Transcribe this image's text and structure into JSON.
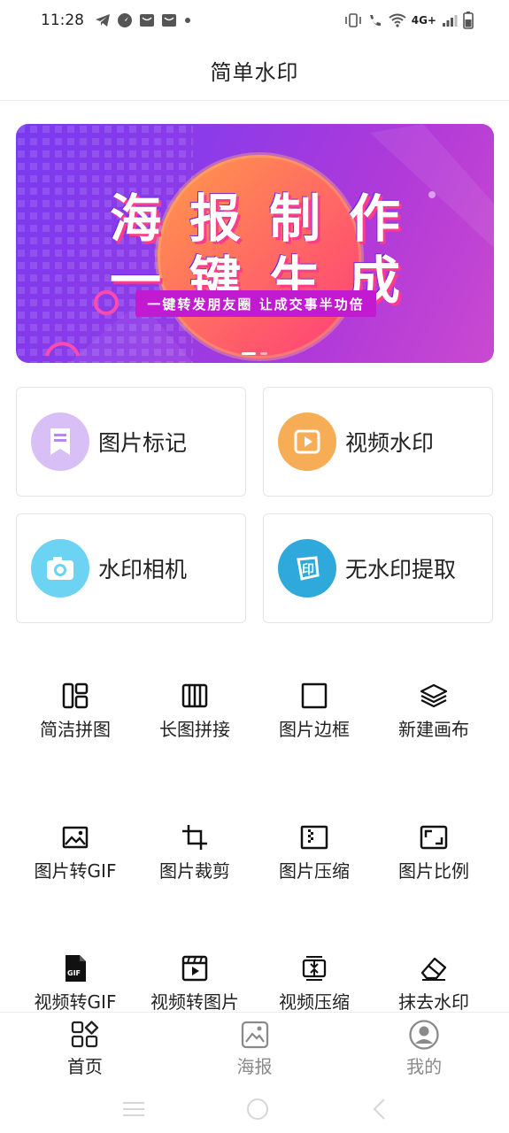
{
  "status_bar": {
    "time": "11:28",
    "network": "4G+"
  },
  "header": {
    "title": "简单水印"
  },
  "banner": {
    "line1": "海报制作",
    "line2": "一键生成",
    "subtitle": "一键转发朋友圈 让成交事半功倍",
    "slide_count": 2,
    "active_slide": 1
  },
  "feature_cards": [
    {
      "label": "图片标记",
      "icon": "bookmark-icon",
      "color": "#c9a6f0"
    },
    {
      "label": "视频水印",
      "icon": "play-icon",
      "color": "#f5a84b"
    },
    {
      "label": "水印相机",
      "icon": "camera-icon",
      "color": "#5bcff0"
    },
    {
      "label": "无水印提取",
      "icon": "print-seal-icon",
      "color": "#2fa8dc"
    }
  ],
  "tools": [
    {
      "label": "简洁拼图",
      "icon": "layout-grid-icon"
    },
    {
      "label": "长图拼接",
      "icon": "columns-icon"
    },
    {
      "label": "图片边框",
      "icon": "square-frame-icon"
    },
    {
      "label": "新建画布",
      "icon": "layers-icon"
    },
    {
      "label": "图片转GIF",
      "icon": "image-icon"
    },
    {
      "label": "图片裁剪",
      "icon": "crop-icon"
    },
    {
      "label": "图片压缩",
      "icon": "compress-image-icon"
    },
    {
      "label": "图片比例",
      "icon": "aspect-ratio-icon"
    },
    {
      "label": "视频转GIF",
      "icon": "gif-file-icon"
    },
    {
      "label": "视频转图片",
      "icon": "video-frame-icon"
    },
    {
      "label": "视频压缩",
      "icon": "video-compress-icon"
    },
    {
      "label": "抹去水印",
      "icon": "eraser-icon"
    }
  ],
  "bottom_nav": [
    {
      "label": "首页",
      "icon": "home-grid-icon",
      "active": true
    },
    {
      "label": "海报",
      "icon": "poster-image-icon",
      "active": false
    },
    {
      "label": "我的",
      "icon": "profile-icon",
      "active": false
    }
  ],
  "colors": {
    "accent": "#222222",
    "inactive": "#8a8a8a",
    "banner_start": "#7a3af0",
    "banner_end": "#c94ad0"
  }
}
